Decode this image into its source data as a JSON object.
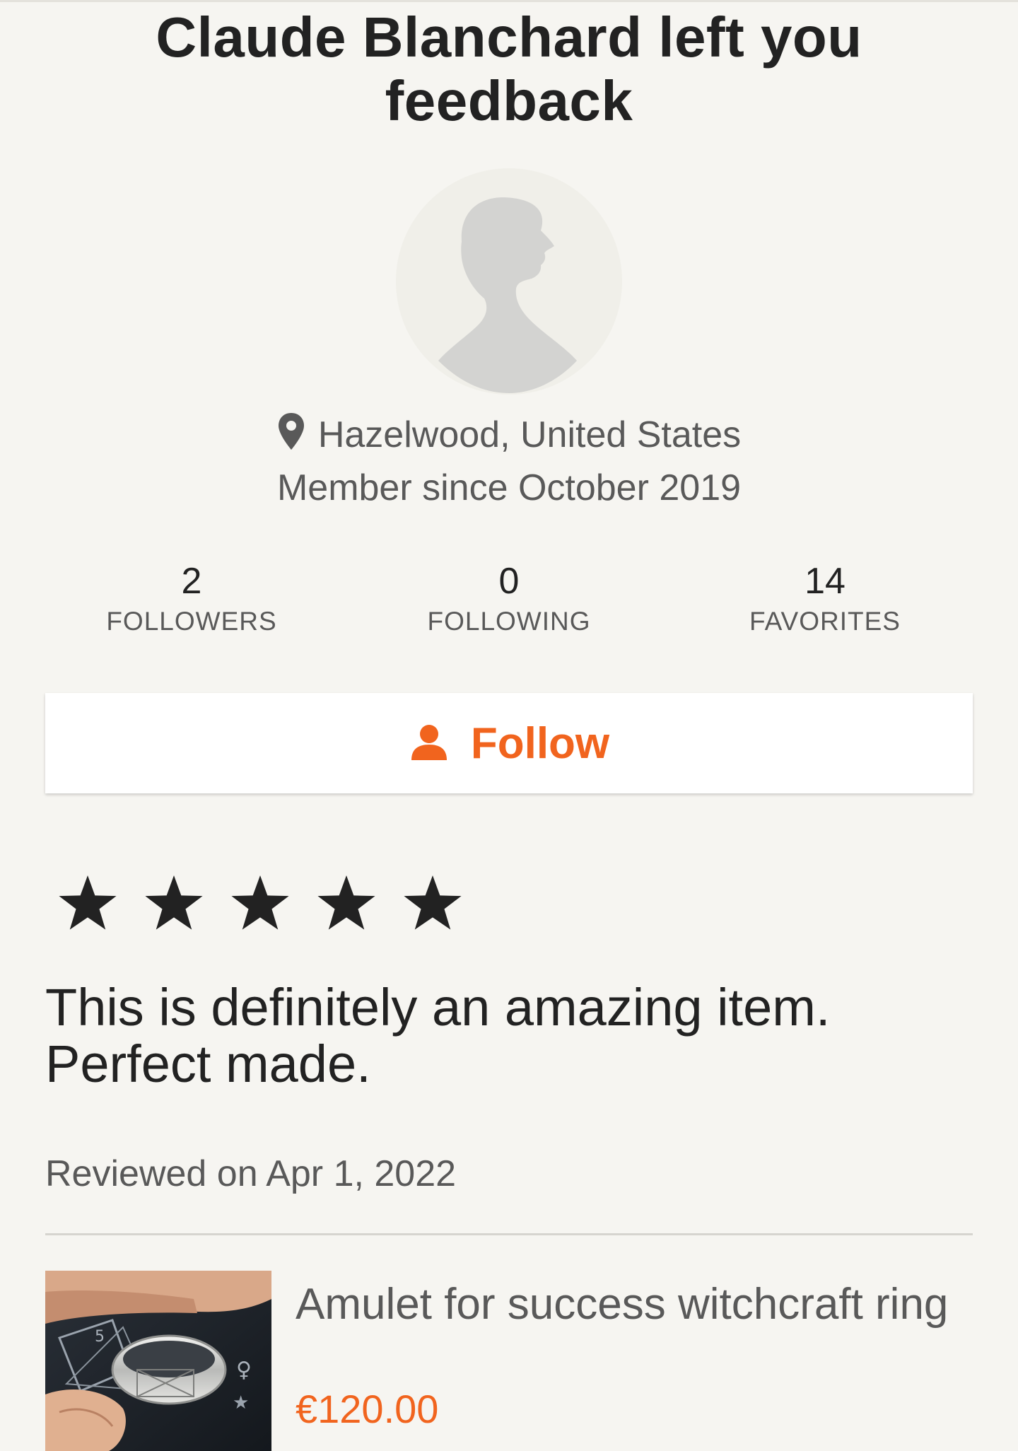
{
  "header": {
    "title": "Claude Blanchard left you feedback"
  },
  "profile": {
    "avatar_icon": "person-silhouette-icon",
    "location": "Hazelwood, United States",
    "member_since": "Member since October 2019",
    "stats": [
      {
        "value": "2",
        "label": "FOLLOWERS"
      },
      {
        "value": "0",
        "label": "FOLLOWING"
      },
      {
        "value": "14",
        "label": "FAVORITES"
      }
    ],
    "follow_label": "Follow"
  },
  "review": {
    "rating": 5,
    "rating_max": 5,
    "text": "This is definitely an amazing item. Perfect made.",
    "date": "Reviewed on Apr 1, 2022"
  },
  "product": {
    "title": "Amulet for success witchcraft ring",
    "price": "€120.00"
  },
  "colors": {
    "background": "#f6f5f1",
    "accent": "#f1641e",
    "text_primary": "#222222",
    "text_secondary": "#595959"
  }
}
